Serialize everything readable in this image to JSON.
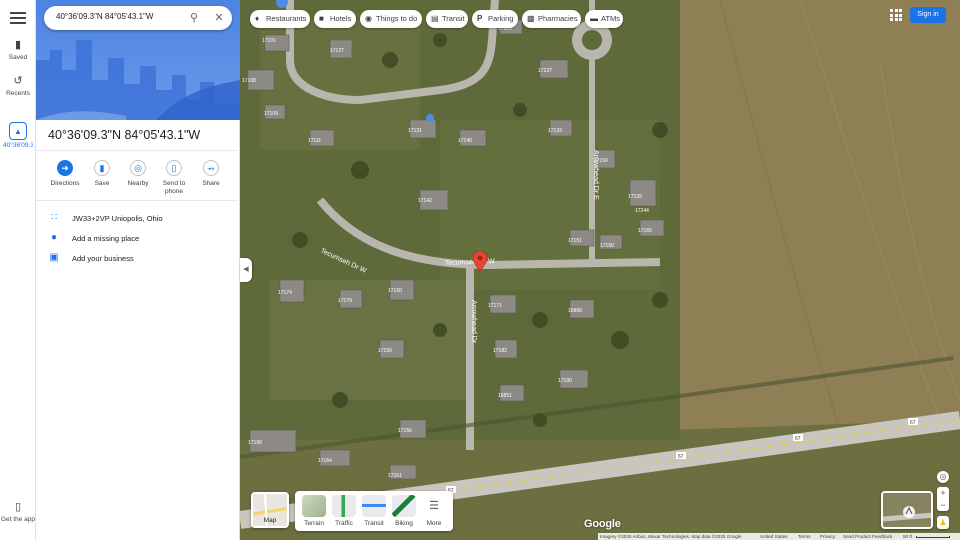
{
  "search": {
    "value": "40°36'09.3\"N 84°05'43.1\"W"
  },
  "rail": {
    "saved": "Saved",
    "recents": "Recents",
    "current": "40°36'09.3\"N",
    "get_app": "Get the app"
  },
  "place": {
    "title": "40°36'09.3\"N 84°05'43.1\"W",
    "actions": [
      "Directions",
      "Save",
      "Nearby",
      "Send to phone",
      "Share"
    ],
    "plus_code": "JW33+2VP Uniopolis, Ohio",
    "add_missing_place": "Add a missing place",
    "add_business": "Add your business"
  },
  "chips": [
    "Restaurants",
    "Hotels",
    "Things to do",
    "Transit",
    "Parking",
    "Pharmacies",
    "ATMs"
  ],
  "header": {
    "sign_in": "Sign in"
  },
  "layers": {
    "map_label": "Map",
    "options": [
      "Terrain",
      "Traffic",
      "Transit",
      "Biking",
      "More"
    ]
  },
  "map": {
    "street_tecumseh": "Tecumseh Dr W",
    "street_arrowhead": "Arrowhead Dr",
    "street_arrowhead_e": "Arrowhead Dr E",
    "route_number": "67",
    "house_numbers": [
      "17101",
      "17108",
      "17109",
      "17111",
      "17127",
      "17131",
      "17142",
      "17140",
      "17123",
      "17137",
      "17133",
      "17139",
      "17156",
      "17151",
      "17150",
      "17165",
      "17174",
      "17179",
      "17156",
      "17160",
      "17171",
      "17182",
      "16851",
      "16868",
      "17190",
      "17198",
      "17164",
      "17156",
      "17261",
      "17244"
    ],
    "logo": "Google"
  },
  "footer": {
    "imagery": "Imagery ©2025 Airbus, Maxar Technologies, Map data ©2025 Google",
    "country": "United States",
    "terms": "Terms",
    "privacy": "Privacy",
    "feedback": "Send Product Feedback",
    "scale": "50 ft"
  },
  "colors": {
    "accent": "#1a73e8",
    "pin": "#ea4335"
  }
}
